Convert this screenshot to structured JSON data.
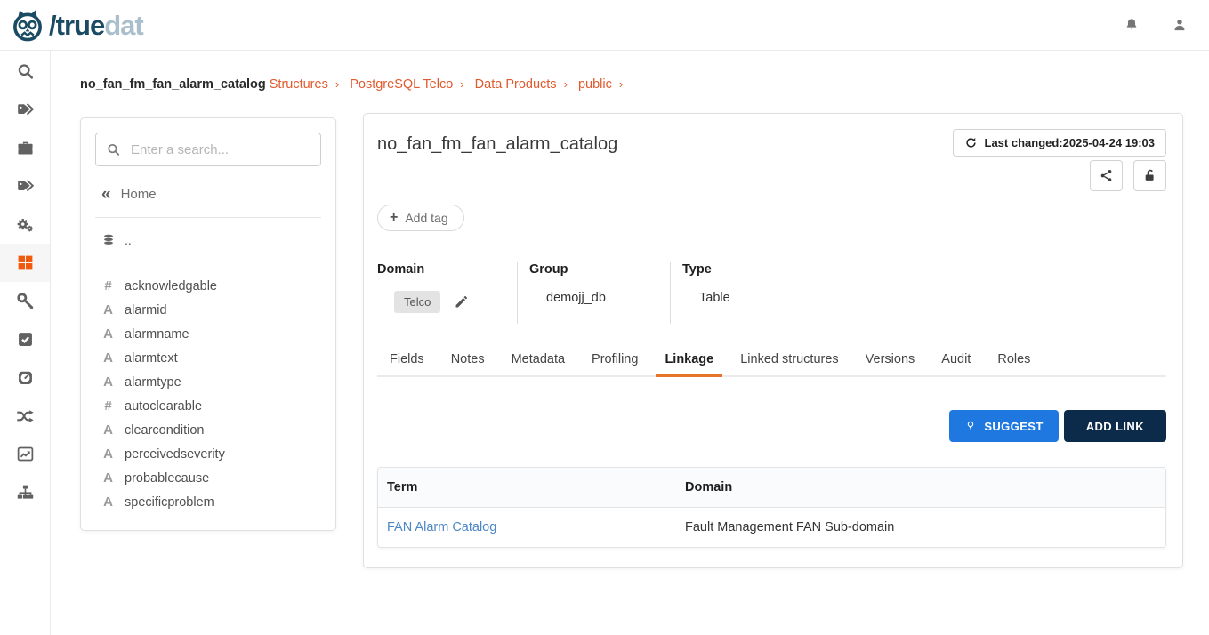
{
  "colors": {
    "accent_orange": "#E8742C",
    "breadcrumb_orange": "#E15A2D",
    "active_icon_orange": "#F0590E",
    "brand_dark_blue": "#1B4A63",
    "brand_light_blue": "#A9BFCB",
    "suggest_blue": "#1E78E0",
    "add_link_navy": "#0C2B4B",
    "term_link_blue": "#4D87C5"
  },
  "header": {
    "brand_slash": "/",
    "brand_true": "true",
    "brand_dat": "dat"
  },
  "breadcrumb": {
    "links": [
      "Structures",
      "PostgreSQL Telco",
      "Data Products",
      "public"
    ],
    "separator": "›",
    "current": "no_fan_fm_fan_alarm_catalog"
  },
  "rail": {
    "items": [
      "search",
      "tags",
      "briefcase",
      "tags",
      "gears",
      "grid",
      "key",
      "check-square",
      "gauge",
      "shuffle",
      "chart-line",
      "sitemap"
    ],
    "active_item": "grid"
  },
  "left_panel": {
    "search_placeholder": "Enter a search...",
    "home_chevron": "«",
    "home_label": "Home",
    "up_item_label": "..",
    "fields": [
      {
        "icon": "#",
        "name": "acknowledgable"
      },
      {
        "icon": "A",
        "name": "alarmid"
      },
      {
        "icon": "A",
        "name": "alarmname"
      },
      {
        "icon": "A",
        "name": "alarmtext"
      },
      {
        "icon": "A",
        "name": "alarmtype"
      },
      {
        "icon": "#",
        "name": "autoclearable"
      },
      {
        "icon": "A",
        "name": "clearcondition"
      },
      {
        "icon": "A",
        "name": "perceivedseverity"
      },
      {
        "icon": "A",
        "name": "probablecause"
      },
      {
        "icon": "A",
        "name": "specificproblem"
      }
    ]
  },
  "main": {
    "title": "no_fan_fm_fan_alarm_catalog",
    "last_changed": "Last changed:2025-04-24 19:03",
    "add_tag_plus": "+",
    "add_tag": "Add tag",
    "attributes": {
      "domain_label": "Domain",
      "domain_value": "Telco",
      "group_label": "Group",
      "group_value": "demojj_db",
      "type_label": "Type",
      "type_value": "Table"
    },
    "tabs": [
      {
        "label": "Fields"
      },
      {
        "label": "Notes"
      },
      {
        "label": "Metadata"
      },
      {
        "label": "Profiling"
      },
      {
        "label": "Linkage",
        "modifier": "active"
      },
      {
        "label": "Linked structures"
      },
      {
        "label": "Versions"
      },
      {
        "label": "Audit"
      },
      {
        "label": "Roles"
      }
    ],
    "actions": {
      "suggest": "SUGGEST",
      "add_link": "ADD LINK"
    },
    "links_table": {
      "columns": [
        "Term",
        "Domain"
      ],
      "rows": [
        {
          "term": "FAN Alarm Catalog",
          "domain": "Fault Management FAN Sub-domain"
        }
      ]
    }
  }
}
